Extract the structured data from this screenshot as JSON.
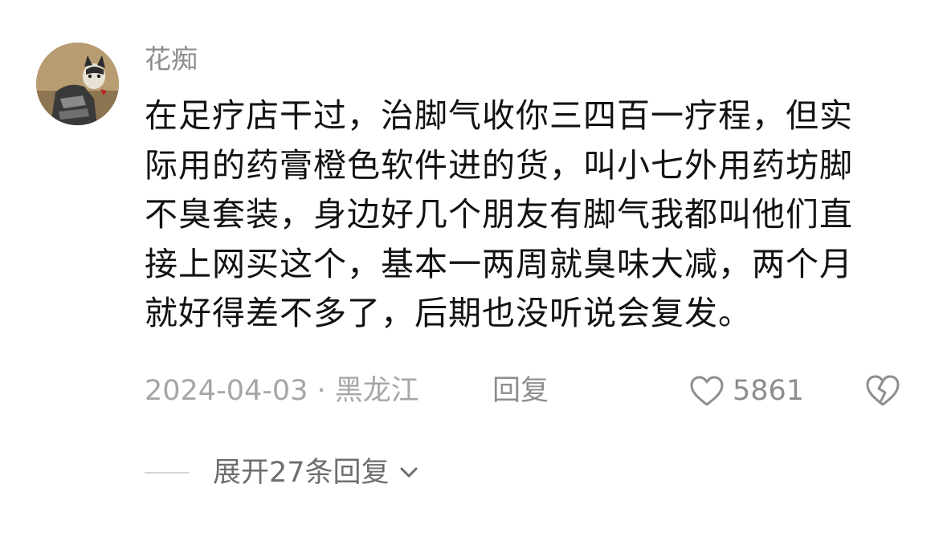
{
  "comment": {
    "username": "花痴",
    "lines": [
      "在足疗店干过，治脚气收你三四百一疗程，但实",
      "际用的药膏橙色软件进的货，叫小七外用药坊脚",
      "不臭套装，身边好几个朋友有脚气我都叫他们直",
      "接上网买这个，基本一两周就臭味大减，两个月",
      "就好得差不多了，后期也没听说会复发。"
    ],
    "date_location": "2024-04-03 · 黑龙江",
    "reply_label": "回复",
    "like_count": "5861",
    "expand_label": "展开27条回复",
    "icons": {
      "like": "heart-outline-icon",
      "dislike": "broken-heart-icon",
      "expand": "chevron-down-icon"
    }
  }
}
